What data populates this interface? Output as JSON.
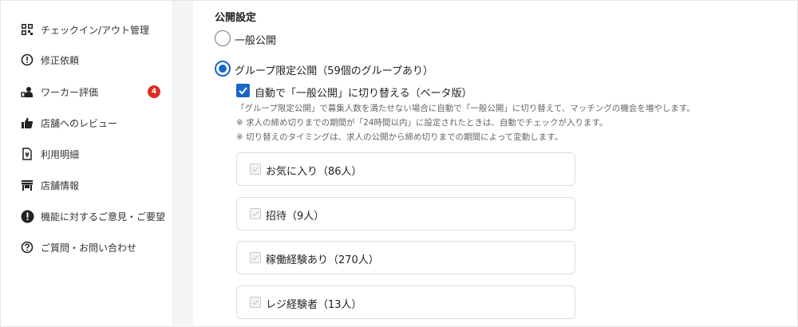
{
  "sidebar": {
    "items": [
      {
        "label": "チェックイン/アウト管理",
        "icon": "qr-code-icon"
      },
      {
        "label": "修正依頼",
        "icon": "alert-circle-icon"
      },
      {
        "label": "ワーカー評価",
        "icon": "worker-rating-icon",
        "badge": "4"
      },
      {
        "label": "店舗へのレビュー",
        "icon": "thumbs-up-icon"
      },
      {
        "label": "利用明細",
        "icon": "receipt-icon"
      },
      {
        "label": "店舗情報",
        "icon": "store-icon"
      },
      {
        "label": "機能に対するご意見・ご要望",
        "icon": "feedback-icon"
      },
      {
        "label": "ご質問・お問い合わせ",
        "icon": "help-icon"
      }
    ]
  },
  "publish": {
    "title": "公開設定",
    "options": [
      {
        "label": "一般公開",
        "selected": false
      },
      {
        "label": "グループ限定公開（59個のグループあり）",
        "selected": true
      }
    ],
    "auto_switch": {
      "label": "自動で「一般公開」に切り替える（ベータ版）",
      "checked": true
    },
    "notes": [
      "「グループ限定公開」で募集人数を満たせない場合に自動で「一般公開」に切り替えて、マッチングの機会を増やします。",
      "※ 求人の締め切りまでの期間が「24時間以内」に設定されたときは、自動でチェックが入ります。",
      "※ 切り替えのタイミングは、求人の公開から締め切りまでの期間によって変動します。"
    ],
    "groups": [
      {
        "label": "お気に入り（86人）",
        "checked": false
      },
      {
        "label": "招待（9人）",
        "checked": false
      },
      {
        "label": "稼働経験あり（270人）",
        "checked": false
      },
      {
        "label": "レジ経験者（13人）",
        "checked": false
      }
    ]
  },
  "colors": {
    "accent": "#1a66c9",
    "badge": "#d93025"
  }
}
